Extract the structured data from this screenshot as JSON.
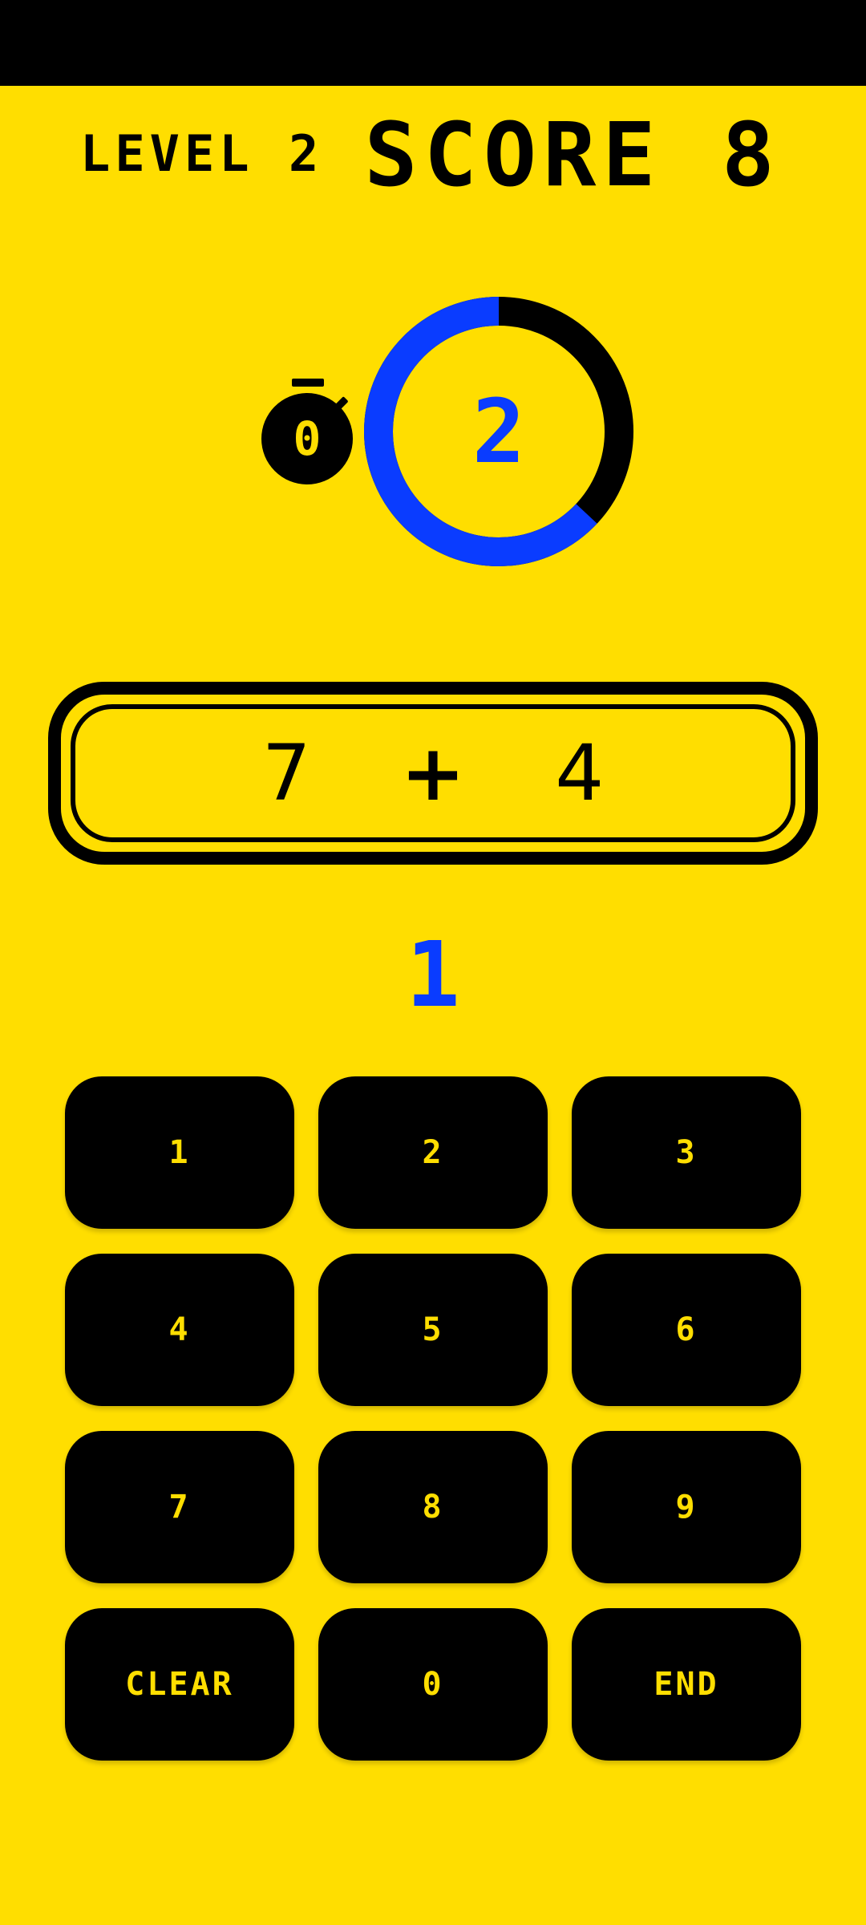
{
  "colors": {
    "background": "#FFDE00",
    "ink": "#000000",
    "accent": "#0A3CFF"
  },
  "header": {
    "level": "LEVEL 2",
    "score": "SCORE 8"
  },
  "timer": {
    "stopwatch_icon": "stopwatch-icon",
    "stopwatch_count": "0",
    "remaining": "2",
    "elapsed_fraction": 0.63
  },
  "problem": {
    "operand_a": "7",
    "operator": "+",
    "operand_b": "4"
  },
  "answer": {
    "value": "1"
  },
  "keypad": {
    "keys": [
      "1",
      "2",
      "3",
      "4",
      "5",
      "6",
      "7",
      "8",
      "9",
      "CLEAR",
      "0",
      "END"
    ]
  }
}
